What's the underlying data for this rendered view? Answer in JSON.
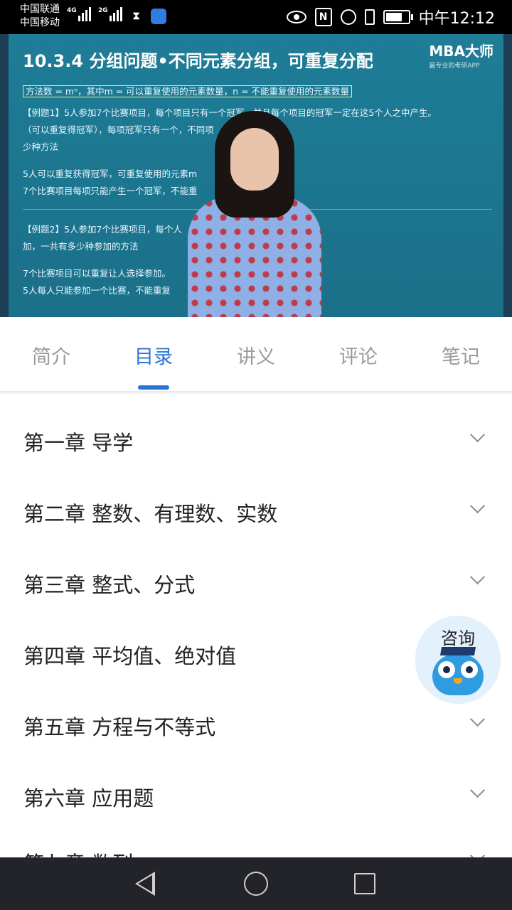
{
  "status_bar": {
    "carrier1": "中国联通",
    "carrier2": "中国移动",
    "net1": "4G",
    "net2": "2G",
    "time": "中午12:12"
  },
  "video": {
    "slide_title": "10.3.4 分组问题•不同元素分组，可重复分配",
    "logo": "MBA大师",
    "logo_sub": "最专业的考研APP",
    "lines": [
      "方法数 = mⁿ，其中m = 可以重复使用的元素数量，n = 不能重复使用的元素数量",
      "【例题1】5人参加7个比赛项目，每个项目只有一个冠军，并且每个项目的冠军一定在这5个人之中产生。",
      "（可以重复得冠军），每项冠军只有一个，不同项",
      "少种方法",
      "5人可以重复获得冠军，可重复使用的元素m",
      "7个比赛项目每项只能产生一个冠军，不能重",
      "【例题2】5人参加7个比赛项目，每个人",
      "加，一共有多少种参加的方法",
      "7个比赛项目可以重复让人选择参加。",
      "5人每人只能参加一个比赛，不能重复"
    ]
  },
  "tabs": [
    {
      "label": "简介",
      "active": false
    },
    {
      "label": "目录",
      "active": true
    },
    {
      "label": "讲义",
      "active": false
    },
    {
      "label": "评论",
      "active": false
    },
    {
      "label": "笔记",
      "active": false
    }
  ],
  "chapters": [
    "第一章  导学",
    "第二章  整数、有理数、实数",
    "第三章  整式、分式",
    "第四章  平均值、绝对值",
    "第五章  方程与不等式",
    "第六章  应用题",
    "第七章  数列"
  ],
  "consult": {
    "label": "咨询"
  },
  "colors": {
    "accent": "#2a73d6",
    "navbar": "#23242a",
    "slide": "#1e7d97"
  }
}
